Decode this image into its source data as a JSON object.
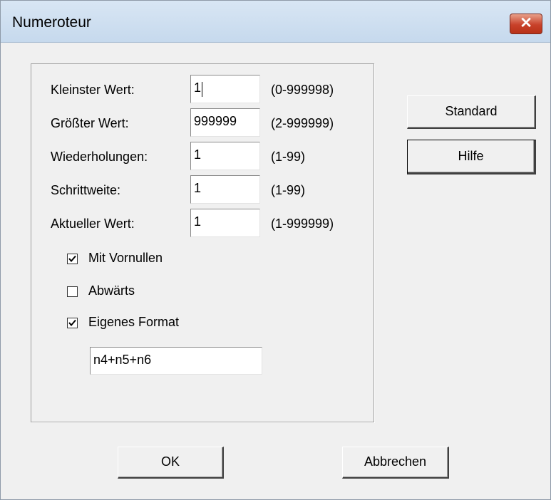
{
  "window": {
    "title": "Numeroteur",
    "close_icon": "close-icon"
  },
  "fields": {
    "min": {
      "label": "Kleinster Wert:",
      "value": "1",
      "range": "(0-999998)"
    },
    "max": {
      "label": "Größter Wert:",
      "value": "999999",
      "range": "(2-999999)"
    },
    "repeat": {
      "label": "Wiederholungen:",
      "value": "1",
      "range": "(1-99)"
    },
    "step": {
      "label": "Schrittweite:",
      "value": "1",
      "range": "(1-99)"
    },
    "current": {
      "label": "Aktueller Wert:",
      "value": "1",
      "range": "(1-999999)"
    }
  },
  "options": {
    "leading_zeros": {
      "label": "Mit Vornullen",
      "checked": true
    },
    "descending": {
      "label": "Abwärts",
      "checked": false
    },
    "custom_format": {
      "label": "Eigenes Format",
      "checked": true
    }
  },
  "format_value": "n4+n5+n6",
  "buttons": {
    "standard": "Standard",
    "help": "Hilfe",
    "ok": "OK",
    "cancel": "Abbrechen"
  }
}
